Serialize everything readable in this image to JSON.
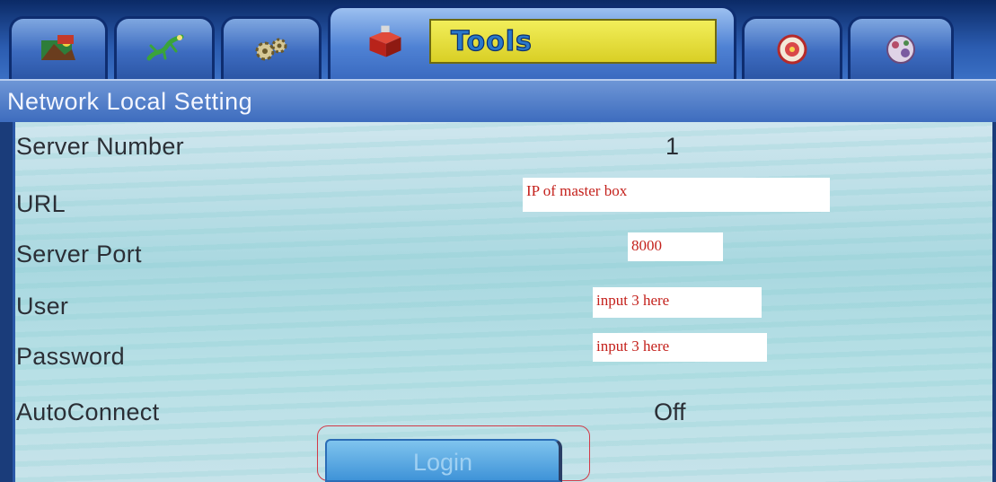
{
  "tabs": [
    {
      "icon": "terrain-icon",
      "active": false
    },
    {
      "icon": "lizard-icon",
      "active": false
    },
    {
      "icon": "gears-icon",
      "active": false
    },
    {
      "icon": "toolbox-icon",
      "active": true,
      "label": "Tools"
    },
    {
      "icon": "disc-icon",
      "active": false
    },
    {
      "icon": "sphere-icon",
      "active": false
    }
  ],
  "header": {
    "title": "Network Local Setting"
  },
  "settings": {
    "server_number": {
      "label": "Server Number",
      "value": "1"
    },
    "url": {
      "label": "URL",
      "note": "IP of master box"
    },
    "server_port": {
      "label": "Server Port",
      "note": "8000"
    },
    "user": {
      "label": "User",
      "note": "input 3 here"
    },
    "password": {
      "label": "Password",
      "note": "input 3 here"
    },
    "autoconnect": {
      "label": "AutoConnect",
      "value": "Off"
    }
  },
  "login": {
    "label": "Login"
  },
  "colors": {
    "tab_blue": "#3d6cc0",
    "active_label_bg": "#e8e046",
    "note_text": "#c4211c",
    "highlight_frame": "#d13a48",
    "panel_bg": "#b8e0e6"
  }
}
